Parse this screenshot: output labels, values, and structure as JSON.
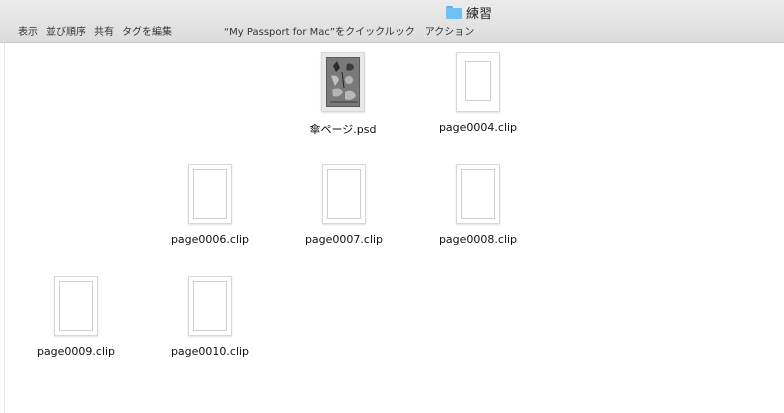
{
  "window": {
    "title": "練習",
    "folder_icon": "folder-icon"
  },
  "toolbar": {
    "view_label": "表示",
    "sort_label": "並び順序",
    "share_label": "共有",
    "tags_label": "タグを編集",
    "quicklook_label": "“My Passport for Mac”をクイックルック",
    "action_label": "アクション"
  },
  "files": [
    {
      "name": "傘ページ.psd",
      "type": "psd"
    },
    {
      "name": "page0004.clip",
      "type": "clip"
    },
    {
      "name": "page0006.clip",
      "type": "clip"
    },
    {
      "name": "page0007.clip",
      "type": "clip"
    },
    {
      "name": "page0008.clip",
      "type": "clip"
    },
    {
      "name": "page0009.clip",
      "type": "clip"
    },
    {
      "name": "page0010.clip",
      "type": "clip"
    }
  ]
}
